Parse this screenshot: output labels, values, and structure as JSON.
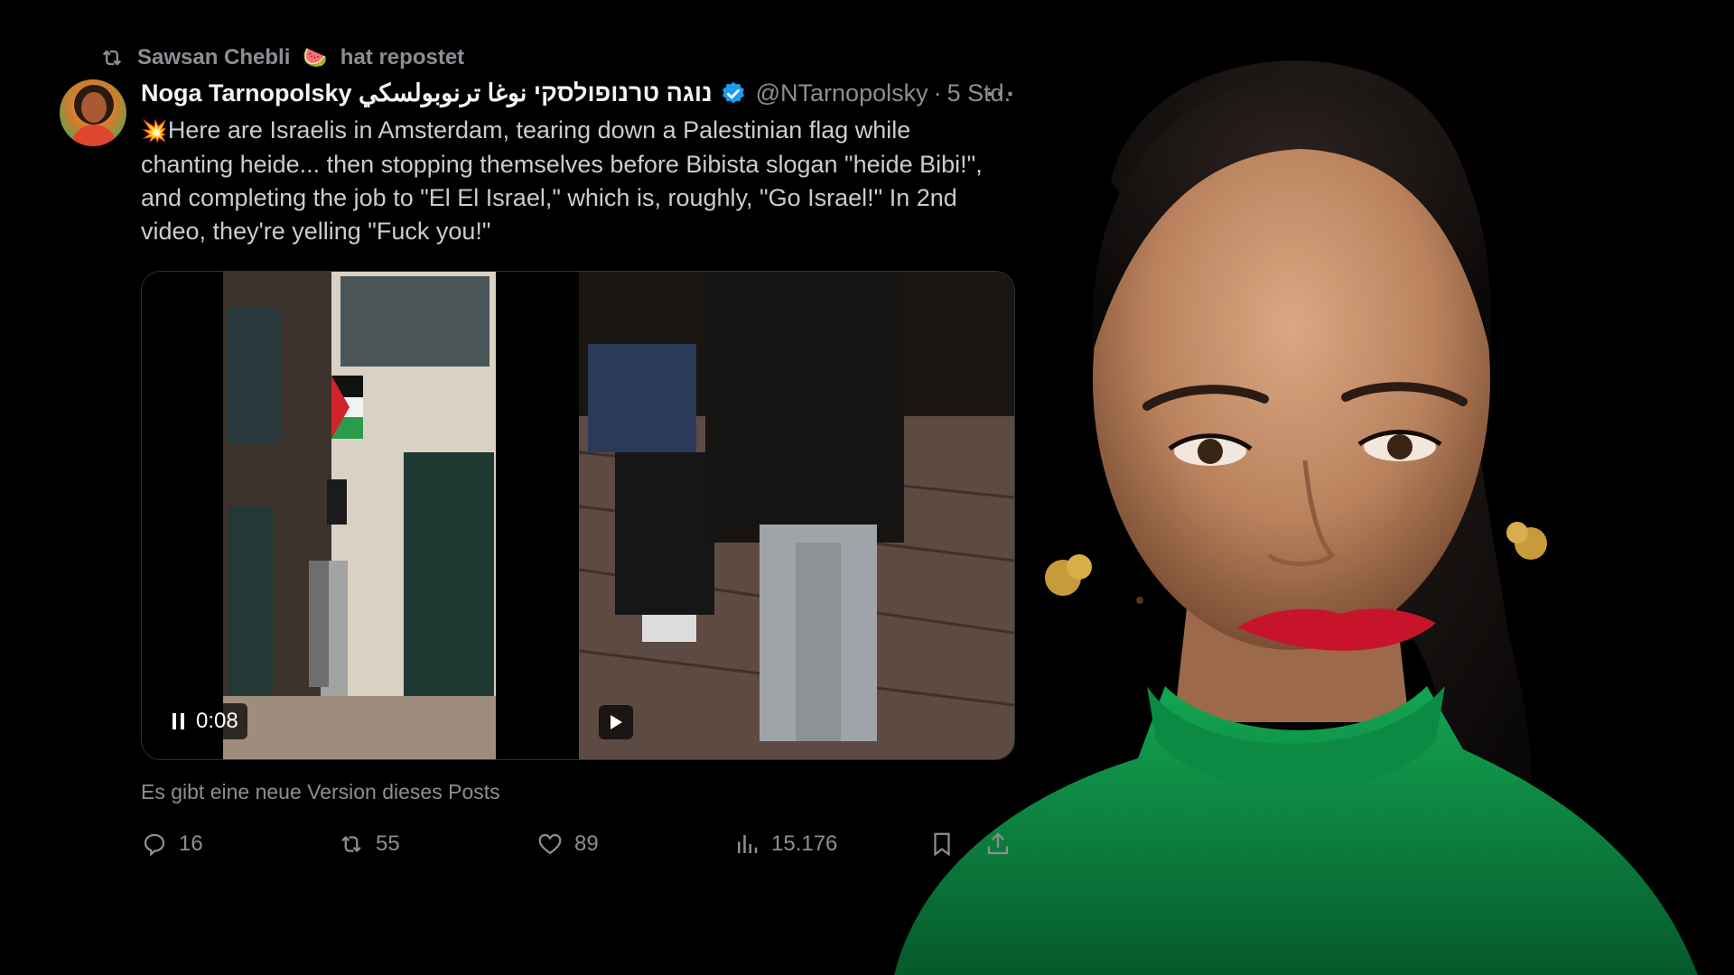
{
  "repost": {
    "reposter": "Sawsan Chebli",
    "emoji": "🍉",
    "suffix": "hat repostet"
  },
  "author": {
    "display_name": "Noga Tarnopolsky נוגה טרנופולסקי نوغا ترنوبولسكي",
    "handle": "@NTarnopolsky",
    "separator": "·",
    "time": "5 Std.",
    "more": "···"
  },
  "tweet": {
    "emoji": "💥",
    "text": "Here are Israelis in Amsterdam, tearing down a Palestinian flag while chanting heide... then stopping themselves before Bibista slogan \"heide Bibi!\", and completing the job to \"El El Israel,\" which is, roughly, \"Go Israel!\" In 2nd video, they're yelling \"Fuck you!\""
  },
  "media": {
    "video1": {
      "time": "0:08",
      "state": "pause-icon"
    },
    "video2": {
      "state": "play-icon"
    }
  },
  "notice": "Es gibt eine neue Version dieses Posts",
  "actions": {
    "reply": {
      "icon": "reply-icon",
      "count": "16"
    },
    "repost": {
      "icon": "repost-icon",
      "count": "55"
    },
    "like": {
      "icon": "heart-icon",
      "count": "89"
    },
    "views": {
      "icon": "views-icon",
      "count": "15.176"
    },
    "bookmark": {
      "icon": "bookmark-icon"
    },
    "share": {
      "icon": "share-icon"
    }
  },
  "colors": {
    "background": "#000000",
    "muted_text": "#8b8f94",
    "body_text": "#c9ccd0",
    "verified_blue": "#1d9bf0",
    "green_top": "#0f8a45"
  }
}
